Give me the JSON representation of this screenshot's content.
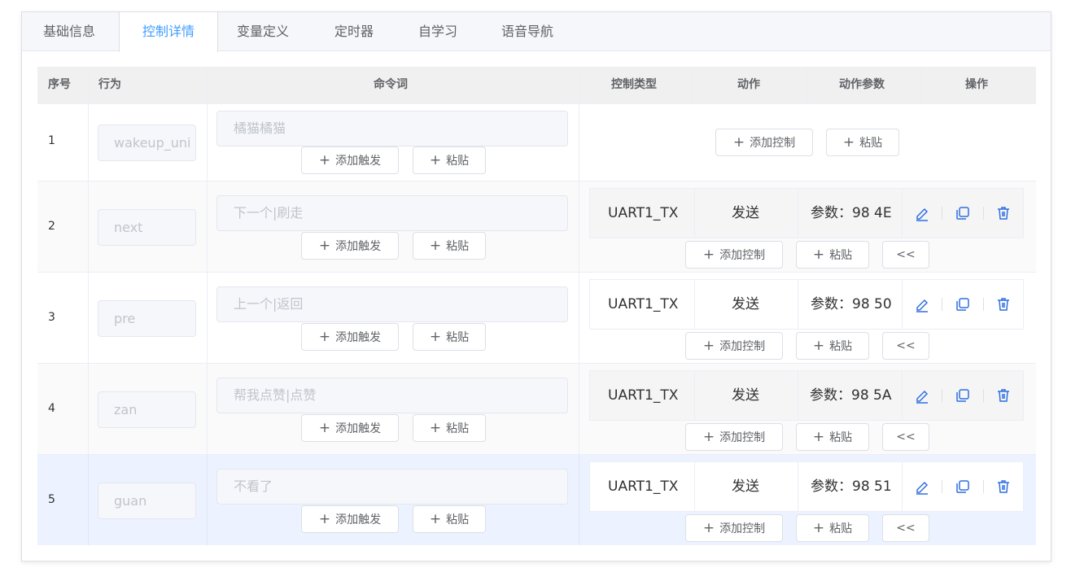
{
  "tabs": [
    {
      "label": "基础信息"
    },
    {
      "label": "控制详情",
      "active": true
    },
    {
      "label": "变量定义"
    },
    {
      "label": "定时器"
    },
    {
      "label": "自学习"
    },
    {
      "label": "语音导航"
    }
  ],
  "table": {
    "headers": {
      "index": "序号",
      "behavior": "行为",
      "command": "命令词",
      "control_type": "控制类型",
      "action": "动作",
      "action_param": "动作参数",
      "operation": "操作"
    },
    "buttons": {
      "add_trigger": "添加触发",
      "paste": "粘贴",
      "add_control": "添加控制",
      "collapse": "<<"
    },
    "rows": [
      {
        "index": "1",
        "behavior": "wakeup_uni",
        "command_placeholder": "橘猫橘猫"
      },
      {
        "index": "2",
        "behavior": "next",
        "command_placeholder": "下一个|刷走",
        "control_type": "UART1_TX",
        "action": "发送",
        "action_param": "参数：98 4E"
      },
      {
        "index": "3",
        "behavior": "pre",
        "command_placeholder": "上一个|返回",
        "control_type": "UART1_TX",
        "action": "发送",
        "action_param": "参数：98 50"
      },
      {
        "index": "4",
        "behavior": "zan",
        "command_placeholder": "帮我点赞|点赞",
        "control_type": "UART1_TX",
        "action": "发送",
        "action_param": "参数：98 5A"
      },
      {
        "index": "5",
        "behavior": "guan",
        "command_placeholder": "不看了",
        "control_type": "UART1_TX",
        "action": "发送",
        "action_param": "参数：98 51"
      }
    ]
  },
  "colors": {
    "accent": "#409eff",
    "icon_blue": "#2f6fe0",
    "highlight_row": "#ecf2ff"
  }
}
